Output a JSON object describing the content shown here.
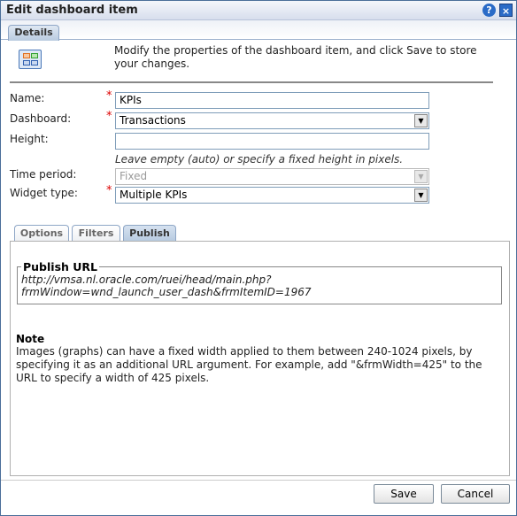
{
  "dialog": {
    "title": "Edit dashboard item",
    "help_icon": "?",
    "close_icon": "×"
  },
  "tabs": [
    {
      "label": "Details",
      "active": true
    }
  ],
  "intro": "Modify the properties of the dashboard item, and click Save to store your changes.",
  "form": {
    "name": {
      "label": "Name:",
      "value": "KPIs",
      "required": true
    },
    "dashboard": {
      "label": "Dashboard:",
      "value": "Transactions",
      "required": true
    },
    "height": {
      "label": "Height:",
      "value": "",
      "hint": "Leave empty (auto) or specify a fixed height in pixels."
    },
    "time_period": {
      "label": "Time period:",
      "value": "Fixed",
      "disabled": true
    },
    "widget_type": {
      "label": "Widget type:",
      "value": "Multiple KPIs",
      "required": true
    },
    "required_mark": "*"
  },
  "subtabs": [
    {
      "label": "Options"
    },
    {
      "label": "Filters"
    },
    {
      "label": "Publish",
      "active": true
    }
  ],
  "publish": {
    "legend": "Publish URL",
    "url_line1": "http://vmsa.nl.oracle.com/ruei/head/main.php?",
    "url_line2": "frmWindow=wnd_launch_user_dash&frmItemID=1967"
  },
  "note": {
    "title": "Note",
    "text": "Images (graphs) can have a fixed width applied to them between 240-1024 pixels, by specifying it as an additional URL argument. For example, add \"&frmWidth=425\" to the URL to specify a width of 425 pixels."
  },
  "buttons": {
    "save": "Save",
    "cancel": "Cancel"
  }
}
